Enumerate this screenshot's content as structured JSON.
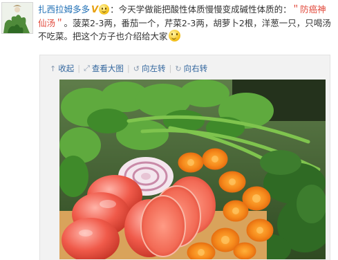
{
  "post": {
    "username": "扎西拉姆多多",
    "badge": "V",
    "text_1": "：今天学做能把酸性体质慢慢变成碱性体质的：",
    "highlight": "＂防癌神仙汤＂",
    "text_2": "。菠菜2-3两，番茄一个，芹菜2-3两，胡萝卜2根，洋葱一只，只喝汤不吃菜。把这个方子也介绍给大家"
  },
  "toolbar": {
    "collapse": {
      "icon": "up-arrow-icon",
      "label": "收起"
    },
    "view_large": {
      "icon": "zoom-icon",
      "label": "查看大图"
    },
    "rotate_left": {
      "icon": "rotate-left-icon",
      "label": "向左转"
    },
    "rotate_right": {
      "icon": "rotate-right-icon",
      "label": "向右转"
    },
    "separator": "|"
  },
  "colors": {
    "link": "#1f6fb5",
    "highlight": "#e24a3c",
    "badge": "#e79f0c"
  }
}
